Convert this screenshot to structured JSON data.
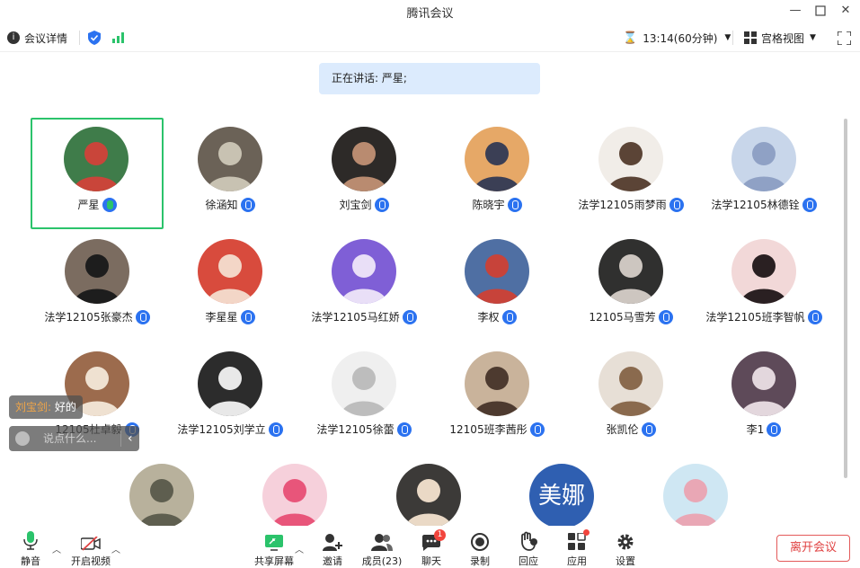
{
  "window": {
    "title": "腾讯会议"
  },
  "topbar": {
    "meeting_info": "会议详情",
    "timer": "13:14(60分钟)",
    "view_mode": "宫格视图"
  },
  "speaking": {
    "label": "正在讲话: 严星;"
  },
  "participants": [
    {
      "name": "严星",
      "active": true
    },
    {
      "name": "徐涵知"
    },
    {
      "name": "刘宝剑"
    },
    {
      "name": "陈晓宇"
    },
    {
      "name": "法学12105雨梦雨"
    },
    {
      "name": "法学12105林德铨"
    },
    {
      "name": "法学12105张豪杰"
    },
    {
      "name": "李星星"
    },
    {
      "name": "法学12105马红娇"
    },
    {
      "name": "李权"
    },
    {
      "name": "12105马雪芳"
    },
    {
      "name": "法学12105班李智帆"
    },
    {
      "name": "12105杜卓毅"
    },
    {
      "name": "法学12105刘学立"
    },
    {
      "name": "法学12105徐蕾"
    },
    {
      "name": "12105班李茜彤"
    },
    {
      "name": "张凯伦"
    },
    {
      "name": "李1"
    },
    {
      "name": ""
    },
    {
      "name": ""
    },
    {
      "name": ""
    },
    {
      "name": "",
      "initials": "美娜"
    },
    {
      "name": ""
    }
  ],
  "chat": {
    "last_sender": "刘宝剑:",
    "last_message": " 好的",
    "placeholder": "说点什么..."
  },
  "toolbar": {
    "mute": "静音",
    "video": "开启视频",
    "share": "共享屏幕",
    "invite": "邀请",
    "members": "成员(23)",
    "chat": "聊天",
    "chat_badge": "1",
    "record": "录制",
    "react": "回应",
    "apps": "应用",
    "settings": "设置",
    "leave": "离开会议"
  },
  "colors": {
    "accent": "#2b72f0",
    "active_border": "#2bc36b",
    "leave": "#e04141"
  }
}
